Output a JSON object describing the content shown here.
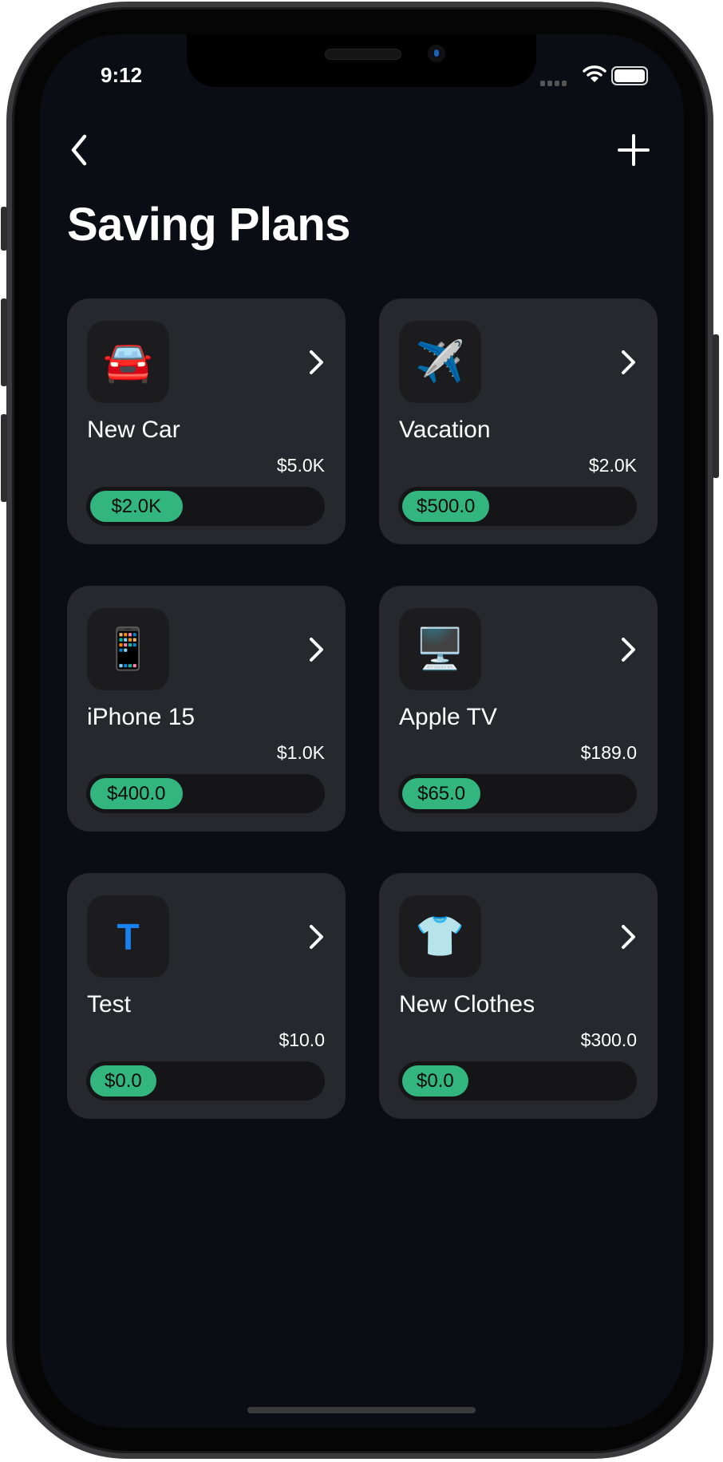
{
  "status_bar": {
    "time": "9:12"
  },
  "header": {
    "back_icon": "chevron-left",
    "add_icon": "plus",
    "title": "Saving Plans"
  },
  "colors": {
    "background": "#0a0d14",
    "card": "#27282d",
    "accent": "#33b57f",
    "letter_icon": "#1a82f0"
  },
  "plans": [
    {
      "icon": "🚘",
      "icon_name": "car-icon",
      "name": "New Car",
      "target": "$5.0K",
      "saved": "$2.0K",
      "progress": 0.4
    },
    {
      "icon": "✈️",
      "icon_name": "airplane-icon",
      "name": "Vacation",
      "target": "$2.0K",
      "saved": "$500.0",
      "progress": 0.25
    },
    {
      "icon": "📱",
      "icon_name": "phone-icon",
      "name": "iPhone 15",
      "target": "$1.0K",
      "saved": "$400.0",
      "progress": 0.4
    },
    {
      "icon": "🖥️",
      "icon_name": "desktop-icon",
      "name": "Apple TV",
      "target": "$189.0",
      "saved": "$65.0",
      "progress": 0.34
    },
    {
      "icon": "T",
      "icon_name": "letter-t-icon",
      "name": "Test",
      "target": "$10.0",
      "saved": "$0.0",
      "progress": 0
    },
    {
      "icon": "👕",
      "icon_name": "shirt-icon",
      "name": "New Clothes",
      "target": "$300.0",
      "saved": "$0.0",
      "progress": 0
    }
  ]
}
